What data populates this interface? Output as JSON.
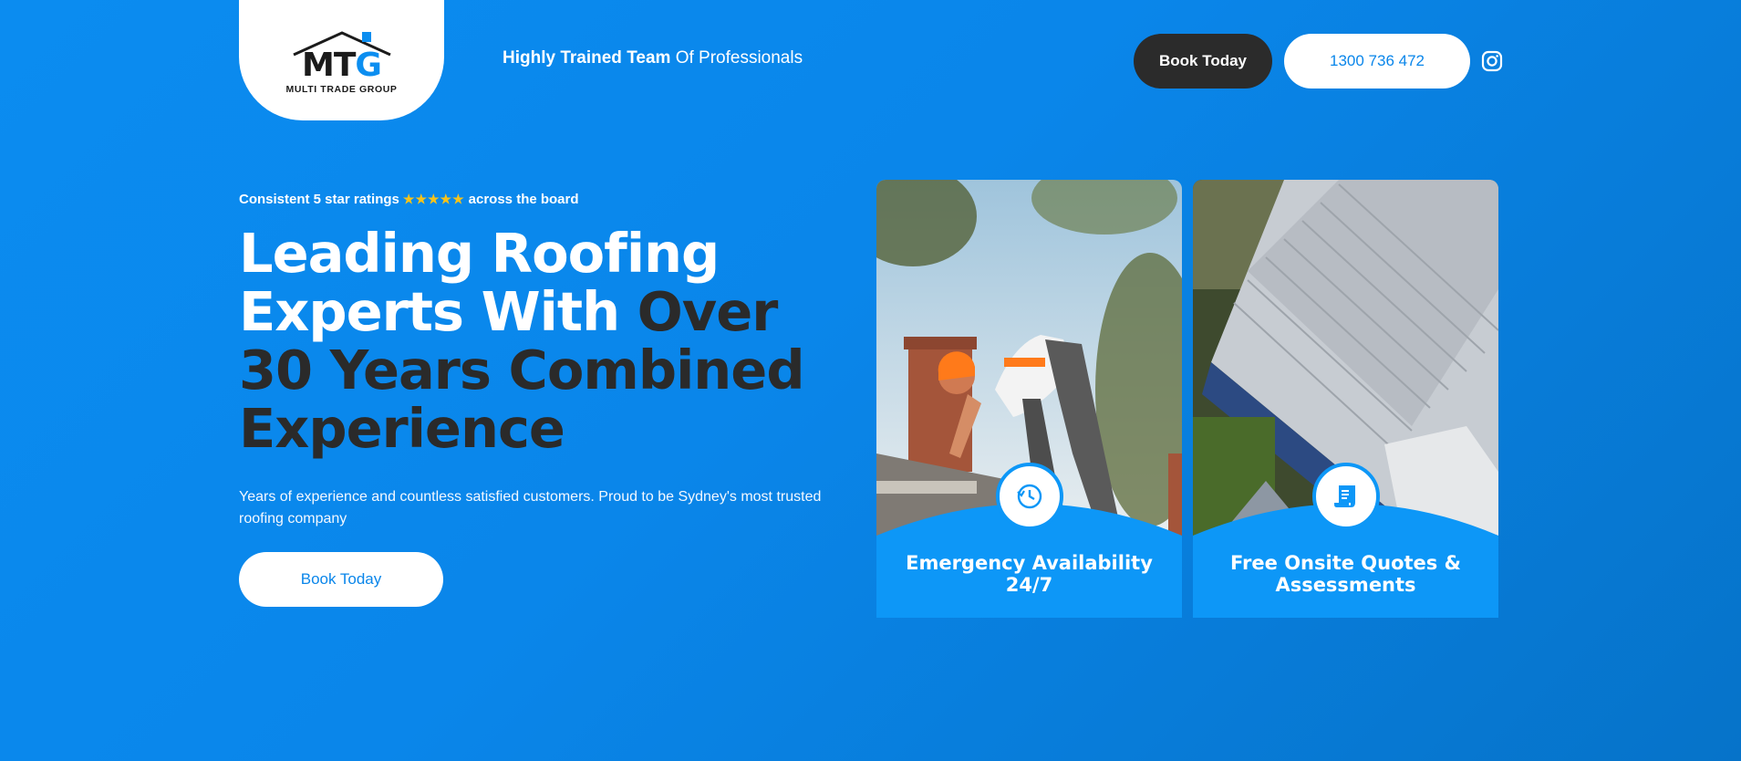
{
  "brand": {
    "logo_letters_mt": "MT",
    "logo_letters_g": "G",
    "logo_sub": "MULTI TRADE GROUP",
    "accent": "#0a86ea",
    "dark": "#2a2a2a"
  },
  "header": {
    "tagline_bold": "Highly Trained Team",
    "tagline_rest": " Of Professionals",
    "book_label": "Book Today",
    "phone_label": "1300 736 472",
    "social_icon": "instagram-icon"
  },
  "hero": {
    "ratings_before": "Consistent 5 star ratings",
    "stars": "★★★★★",
    "ratings_after": "across the board",
    "headline_white": "Leading Roofing Experts With ",
    "headline_dark": "Over 30 Years Combined Experience",
    "description": "Years of experience and countless satisfied customers. Proud to be Sydney's most trusted roofing company",
    "cta_label": "Book Today"
  },
  "cards": [
    {
      "title": "Emergency Availability 24/7",
      "icon": "clock-refresh-icon"
    },
    {
      "title": "Free Onsite Quotes & Assessments",
      "icon": "document-scroll-icon"
    }
  ]
}
